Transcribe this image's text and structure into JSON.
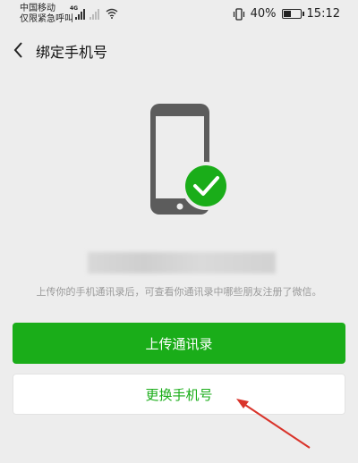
{
  "status_bar": {
    "carrier_line1": "中国移动",
    "carrier_line2": "仅限紧急呼叫",
    "network": "4G",
    "battery": "40%",
    "time": "15:12"
  },
  "nav": {
    "title": "绑定手机号"
  },
  "main": {
    "description": "上传你的手机通讯录后，可查看你通讯录中哪些朋友注册了微信。",
    "upload_button": "上传通讯录",
    "change_button": "更换手机号"
  },
  "colors": {
    "accent": "#1aad19",
    "phone": "#5c5c5c"
  }
}
